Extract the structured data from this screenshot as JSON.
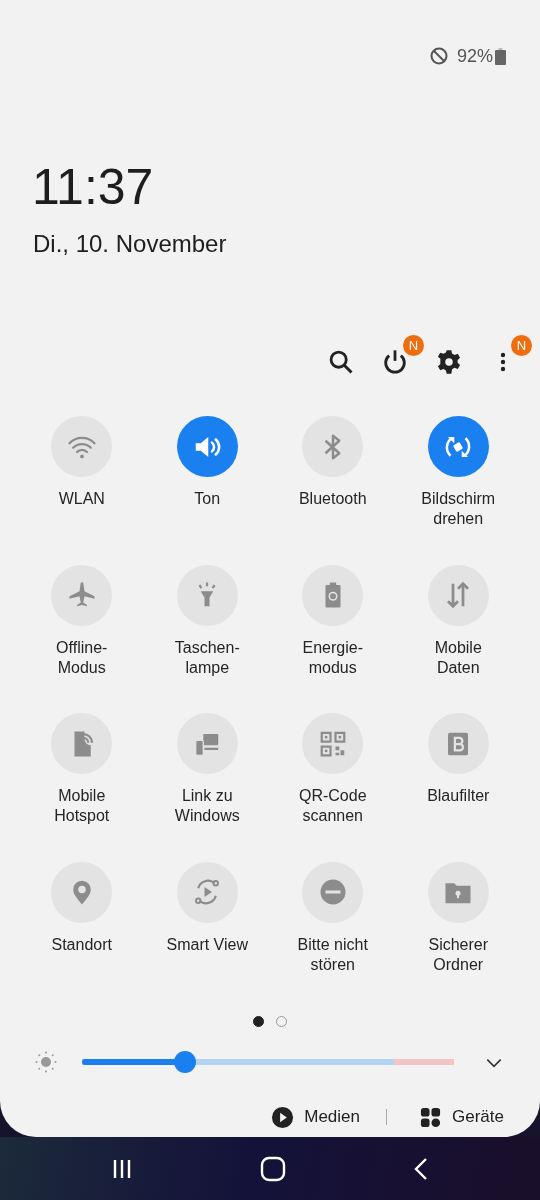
{
  "status_bar": {
    "battery": "92%"
  },
  "clock": {
    "time": "11:37",
    "date": "Di., 10. November"
  },
  "header_actions": [
    {
      "kind": "search"
    },
    {
      "kind": "power",
      "badge": "N"
    },
    {
      "kind": "settings"
    },
    {
      "kind": "more",
      "badge": "N"
    }
  ],
  "tiles": [
    {
      "label": "WLAN",
      "on": false
    },
    {
      "label": "Ton",
      "on": true
    },
    {
      "label": "Bluetooth",
      "on": false
    },
    {
      "label": "Bildschirm drehen",
      "on": true
    },
    {
      "label": "Offline-\nModus",
      "on": false
    },
    {
      "label": "Taschen-\nlampe",
      "on": false
    },
    {
      "label": "Energie-\nmodus",
      "on": false
    },
    {
      "label": "Mobile\nDaten",
      "on": false
    },
    {
      "label": "Mobile\nHotspot",
      "on": false
    },
    {
      "label": "Link zu\nWindows",
      "on": false
    },
    {
      "label": "QR-Code\nscannen",
      "on": false
    },
    {
      "label": "Blaufilter",
      "on": false
    },
    {
      "label": "Standort",
      "on": false
    },
    {
      "label": "Smart View",
      "on": false
    },
    {
      "label": "Bitte nicht\nstören",
      "on": false
    },
    {
      "label": "Sicherer\nOrdner",
      "on": false
    }
  ],
  "pages": [
    {
      "selected": true
    },
    {
      "selected": false
    }
  ],
  "brightness": {
    "level": 0.277
  },
  "bottom_buttons": [
    {
      "kind": "media",
      "label": "Medien"
    },
    {
      "kind": "devices",
      "label": "Geräte"
    }
  ]
}
